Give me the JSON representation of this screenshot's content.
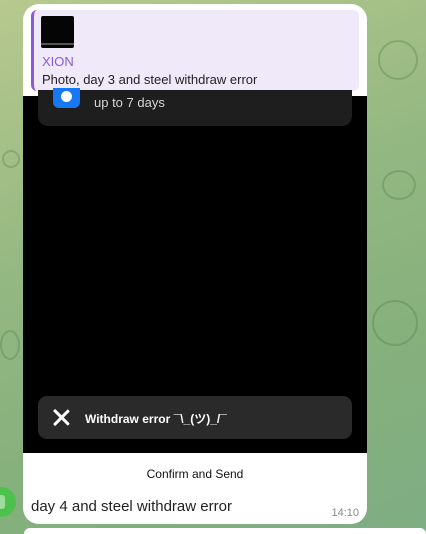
{
  "reply": {
    "sender": "XION",
    "preview": "Photo, day 3 and steel withdraw error"
  },
  "screenshot": {
    "notification_text": "up to 7 days",
    "toast_text": "Withdraw error ¯\\_(ツ)_/¯"
  },
  "confirm_label": "Confirm and Send",
  "message": {
    "text": "day 4 and steel withdraw error",
    "time": "14:10"
  }
}
